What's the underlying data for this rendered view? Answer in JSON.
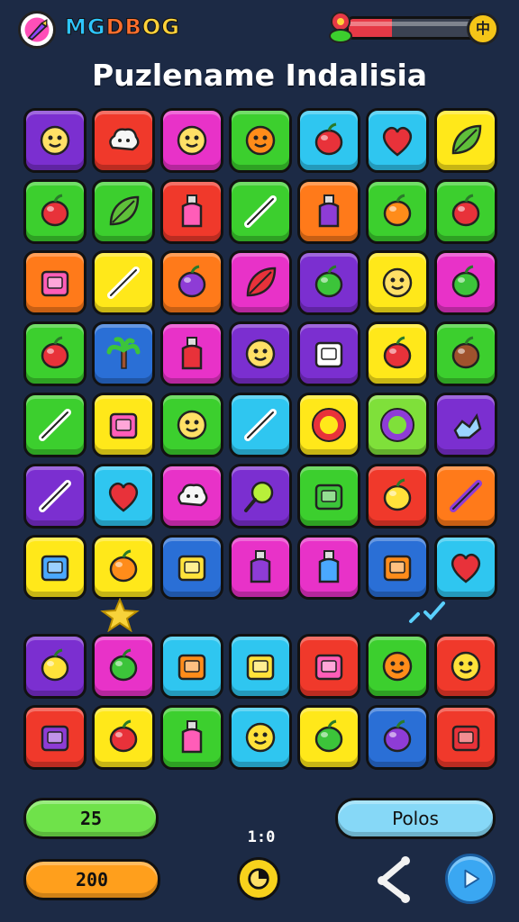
{
  "header": {
    "logo_text": "MGDBOG",
    "logo_parts": [
      "MG",
      "DB",
      "OG"
    ],
    "health_percent": 33,
    "coin_button_symbol": "中"
  },
  "title": "Puzlename Indalisia",
  "colors": {
    "background": "#1c2a45",
    "purple": "#7b2fd0",
    "red": "#f0392b",
    "magenta": "#e832c8",
    "green": "#3ccf2e",
    "cyan": "#2fc6f0",
    "yellow": "#ffe81a",
    "orange": "#ff7a1a",
    "blue": "#2a6fd6",
    "lime": "#7fe03a",
    "pink": "#ff3aa6"
  },
  "board_top": [
    [
      [
        "purple",
        "ghost-face-icon"
      ],
      [
        "red",
        "speech-bubble-icon"
      ],
      [
        "magenta",
        "smiley-face-icon"
      ],
      [
        "green",
        "orange-face-icon"
      ],
      [
        "cyan",
        "red-apple-icon"
      ],
      [
        "cyan",
        "red-heart-icon"
      ],
      [
        "yellow",
        "leaf-icon"
      ]
    ],
    [
      [
        "green",
        "red-balloon-icon"
      ],
      [
        "green",
        "leaf-icon"
      ],
      [
        "red",
        "pink-jar-icon"
      ],
      [
        "green",
        "crossed-sticks-icon"
      ],
      [
        "orange",
        "purple-bottle-icon"
      ],
      [
        "green",
        "orange-bell-icon"
      ],
      [
        "green",
        "red-fruit-icon"
      ]
    ],
    [
      [
        "orange",
        "pink-box-icon"
      ],
      [
        "yellow",
        "scissors-icon"
      ],
      [
        "orange",
        "purple-berry-icon"
      ],
      [
        "magenta",
        "red-leaf-icon"
      ],
      [
        "purple",
        "green-cone-icon"
      ],
      [
        "yellow",
        "sun-flower-icon"
      ],
      [
        "magenta",
        "green-lemon-icon"
      ]
    ],
    [
      [
        "green",
        "red-rattle-icon"
      ],
      [
        "blue",
        "palm-tree-icon"
      ],
      [
        "magenta",
        "red-bottle-icon"
      ],
      [
        "purple",
        "roast-chicken-icon"
      ],
      [
        "purple",
        "cheese-icon"
      ],
      [
        "yellow",
        "red-pepper-icon"
      ],
      [
        "green",
        "brown-barrel-icon"
      ]
    ],
    [
      [
        "green",
        "carrot-icon"
      ],
      [
        "yellow",
        "pink-square-icon"
      ],
      [
        "green",
        "robot-face-icon"
      ],
      [
        "cyan",
        "crossed-sticks-icon"
      ],
      [
        "yellow",
        "red-ring-icon"
      ],
      [
        "lime",
        "purple-ring-icon"
      ],
      [
        "purple",
        "blue-crystal-icon"
      ]
    ],
    [
      [
        "purple",
        "pen-nib-icon"
      ],
      [
        "cyan",
        "red-heart-icon"
      ],
      [
        "magenta",
        "white-cloud-icon"
      ],
      [
        "purple",
        "magnifier-icon"
      ],
      [
        "green",
        "green-shirt-icon"
      ],
      [
        "red",
        "yellow-ice-cream-icon"
      ],
      [
        "orange",
        "purple-feather-icon"
      ]
    ],
    [
      [
        "yellow",
        "blue-book-icon"
      ],
      [
        "yellow",
        "orange-cookie-icon"
      ],
      [
        "blue",
        "yellow-cheese-icon"
      ],
      [
        "magenta",
        "purple-potion-icon"
      ],
      [
        "magenta",
        "blue-bottle-icon"
      ],
      [
        "blue",
        "orange-basket-icon"
      ],
      [
        "cyan",
        "red-heart-icon"
      ]
    ]
  ],
  "board_bottom": [
    [
      [
        "purple",
        "yellow-lime-icon"
      ],
      [
        "magenta",
        "green-avocado-icon"
      ],
      [
        "cyan",
        "orange-house-icon"
      ],
      [
        "cyan",
        "yellow-camera-icon"
      ],
      [
        "red",
        "pink-machine-icon"
      ],
      [
        "green",
        "orange-sun-icon"
      ],
      [
        "red",
        "yellow-sunflower-icon"
      ]
    ],
    [
      [
        "red",
        "purple-card-icon"
      ],
      [
        "yellow",
        "red-cherry-icon"
      ],
      [
        "green",
        "pink-vase-icon"
      ],
      [
        "cyan",
        "yellow-chick-icon"
      ],
      [
        "yellow",
        "green-banana-icon"
      ],
      [
        "blue",
        "purple-plum-icon"
      ],
      [
        "red",
        "red-eraser-icon"
      ]
    ]
  ],
  "footer": {
    "score": "25",
    "moves": "200",
    "polos_label": "Polos",
    "timer": "1:0"
  }
}
